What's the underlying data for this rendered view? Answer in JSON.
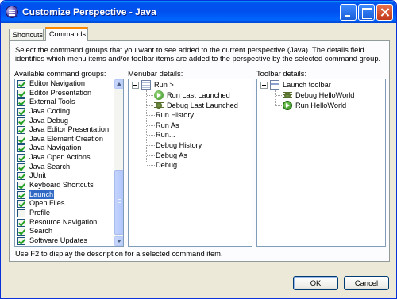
{
  "window": {
    "title": "Customize Perspective - Java"
  },
  "tabs": [
    {
      "label": "Shortcuts",
      "active": false
    },
    {
      "label": "Commands",
      "active": true
    }
  ],
  "description": "Select the command groups that you want to see added to the current perspective (Java).  The details field identifies which menu items and/or toolbar items are added to the perspective by the selected command group.",
  "labels": {
    "groups": "Available command groups:",
    "menubar": "Menubar details:",
    "toolbar": "Toolbar details:"
  },
  "command_groups": [
    {
      "label": "Editor Navigation",
      "checked": true,
      "selected": false
    },
    {
      "label": "Editor Presentation",
      "checked": true,
      "selected": false
    },
    {
      "label": "External Tools",
      "checked": true,
      "selected": false
    },
    {
      "label": "Java Coding",
      "checked": true,
      "selected": false
    },
    {
      "label": "Java Debug",
      "checked": true,
      "selected": false
    },
    {
      "label": "Java Editor Presentation",
      "checked": true,
      "selected": false
    },
    {
      "label": "Java Element Creation",
      "checked": true,
      "selected": false
    },
    {
      "label": "Java Navigation",
      "checked": true,
      "selected": false
    },
    {
      "label": "Java Open Actions",
      "checked": true,
      "selected": false
    },
    {
      "label": "Java Search",
      "checked": true,
      "selected": false
    },
    {
      "label": "JUnit",
      "checked": true,
      "selected": false
    },
    {
      "label": "Keyboard Shortcuts",
      "checked": true,
      "selected": false
    },
    {
      "label": "Launch",
      "checked": true,
      "selected": true
    },
    {
      "label": "Open Files",
      "checked": true,
      "selected": false
    },
    {
      "label": "Profile",
      "checked": false,
      "selected": false
    },
    {
      "label": "Resource Navigation",
      "checked": true,
      "selected": false
    },
    {
      "label": "Search",
      "checked": true,
      "selected": false
    },
    {
      "label": "Software Updates",
      "checked": true,
      "selected": false
    }
  ],
  "menubar_tree": {
    "root": "Run  >",
    "items": [
      {
        "label": "Run Last Launched",
        "icon": "run-last-launched-icon"
      },
      {
        "label": "Debug Last Launched",
        "icon": "debug-last-launched-icon"
      },
      {
        "label": "Run History",
        "icon": ""
      },
      {
        "label": "Run As",
        "icon": ""
      },
      {
        "label": "Run...",
        "icon": ""
      },
      {
        "label": "Debug History",
        "icon": ""
      },
      {
        "label": "Debug As",
        "icon": ""
      },
      {
        "label": "Debug...",
        "icon": ""
      }
    ]
  },
  "toolbar_tree": {
    "root": "Launch toolbar",
    "items": [
      {
        "label": "Debug HelloWorld",
        "icon": "debug-icon"
      },
      {
        "label": "Run HelloWorld",
        "icon": "run-icon"
      }
    ]
  },
  "hint": "Use F2 to display the description for a selected command item.",
  "buttons": {
    "ok": "OK",
    "cancel": "Cancel"
  }
}
